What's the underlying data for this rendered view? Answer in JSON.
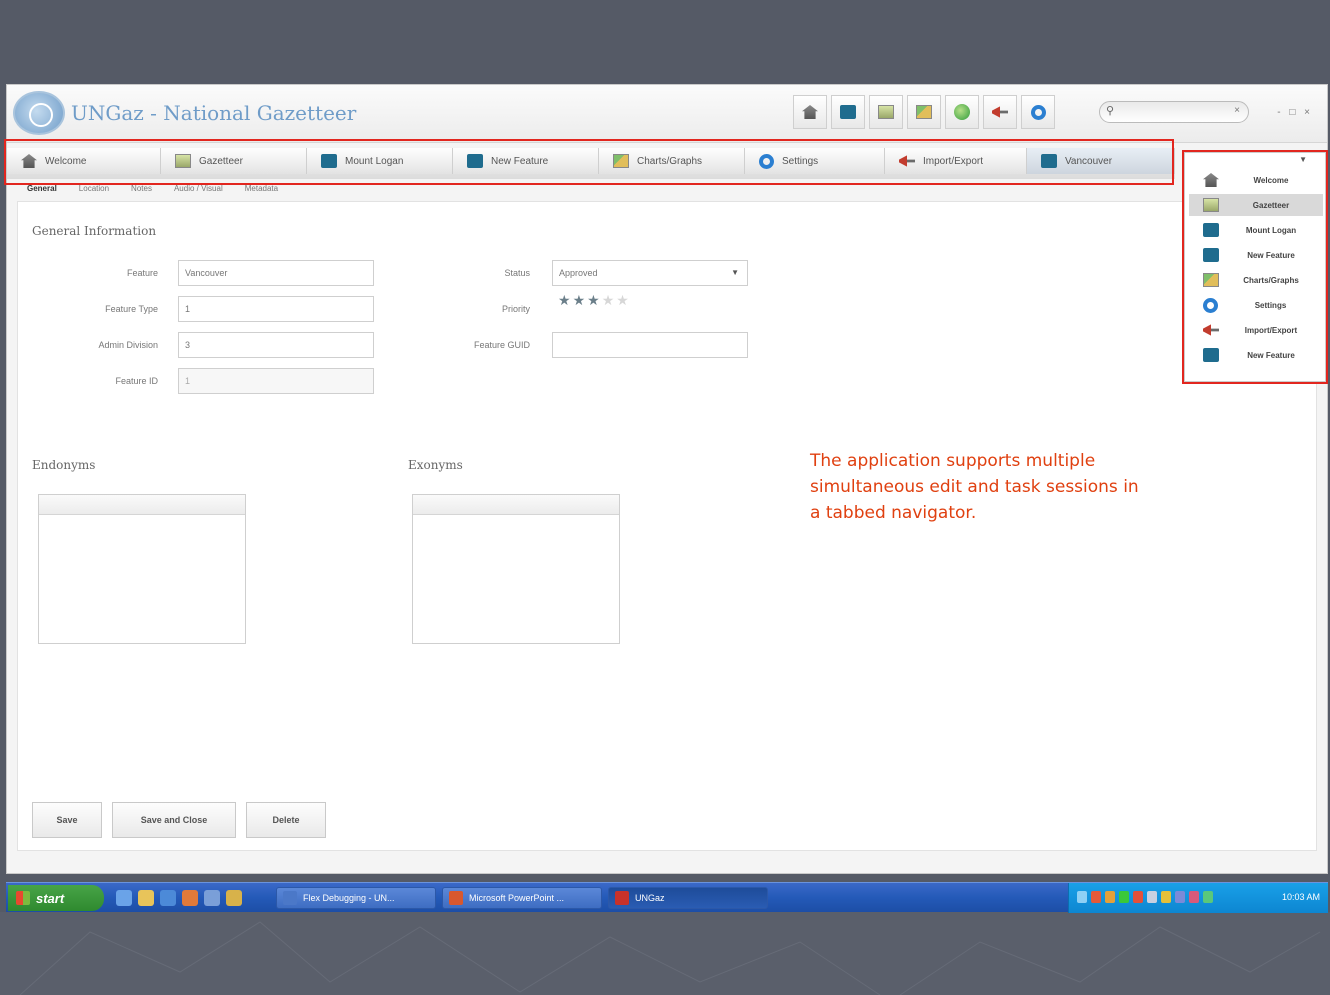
{
  "app": {
    "title": "UNGaz - National Gazetteer",
    "window_controls": "- □ ×"
  },
  "toolbar": {
    "buttons": [
      "house-icon",
      "folder-icon",
      "document-icon",
      "chart-icon",
      "globe-icon",
      "import-export-icon",
      "settings-icon"
    ],
    "search_placeholder": "",
    "search_clear": "×"
  },
  "tabs": [
    {
      "label": "Welcome",
      "icon": "house-icon"
    },
    {
      "label": "Gazetteer",
      "icon": "document-icon"
    },
    {
      "label": "Mount Logan",
      "icon": "folder-icon"
    },
    {
      "label": "New Feature",
      "icon": "folder-icon"
    },
    {
      "label": "Charts/Graphs",
      "icon": "chart-icon"
    },
    {
      "label": "Settings",
      "icon": "settings-icon"
    },
    {
      "label": "Import/Export",
      "icon": "import-export-icon"
    },
    {
      "label": "Vancouver",
      "icon": "folder-icon"
    }
  ],
  "subtabs": [
    "General",
    "Location",
    "Notes",
    "Audio / Visual",
    "Metadata"
  ],
  "general": {
    "section_title": "General Information",
    "feature_label": "Feature",
    "feature_value": "Vancouver",
    "feature_type_label": "Feature Type",
    "feature_type_value": "1",
    "admin_division_label": "Admin Division",
    "admin_division_value": "3",
    "feature_id_label": "Feature ID",
    "feature_id_value": "1",
    "status_label": "Status",
    "status_value": "Approved",
    "priority_label": "Priority",
    "priority_rating": 3,
    "priority_max": 5,
    "feature_guid_label": "Feature GUID",
    "feature_guid_value": ""
  },
  "lists": {
    "endonyms_title": "Endonyms",
    "exonyms_title": "Exonyms"
  },
  "buttons": {
    "save": "Save",
    "save_close": "Save and Close",
    "delete": "Delete"
  },
  "annotation": "The application supports multiple simultaneous edit and task sessions in a tabbed navigator.",
  "dropdown": {
    "items": [
      {
        "label": "Welcome",
        "icon": "house-icon"
      },
      {
        "label": "Gazetteer",
        "icon": "document-icon",
        "selected": true
      },
      {
        "label": "Mount Logan",
        "icon": "folder-icon"
      },
      {
        "label": "New Feature",
        "icon": "folder-icon"
      },
      {
        "label": "Charts/Graphs",
        "icon": "chart-icon"
      },
      {
        "label": "Settings",
        "icon": "settings-icon"
      },
      {
        "label": "Import/Export",
        "icon": "import-export-icon"
      },
      {
        "label": "New Feature",
        "icon": "folder-icon"
      }
    ]
  },
  "taskbar": {
    "start_label": "start",
    "tasks": [
      "Flex Debugging - UN...",
      "Microsoft PowerPoint ...",
      "UNGaz"
    ],
    "clock": "10:03 AM"
  },
  "colors": {
    "highlight": "#e2261f",
    "annotation": "#e04010",
    "brand": "#6f9cc8"
  }
}
